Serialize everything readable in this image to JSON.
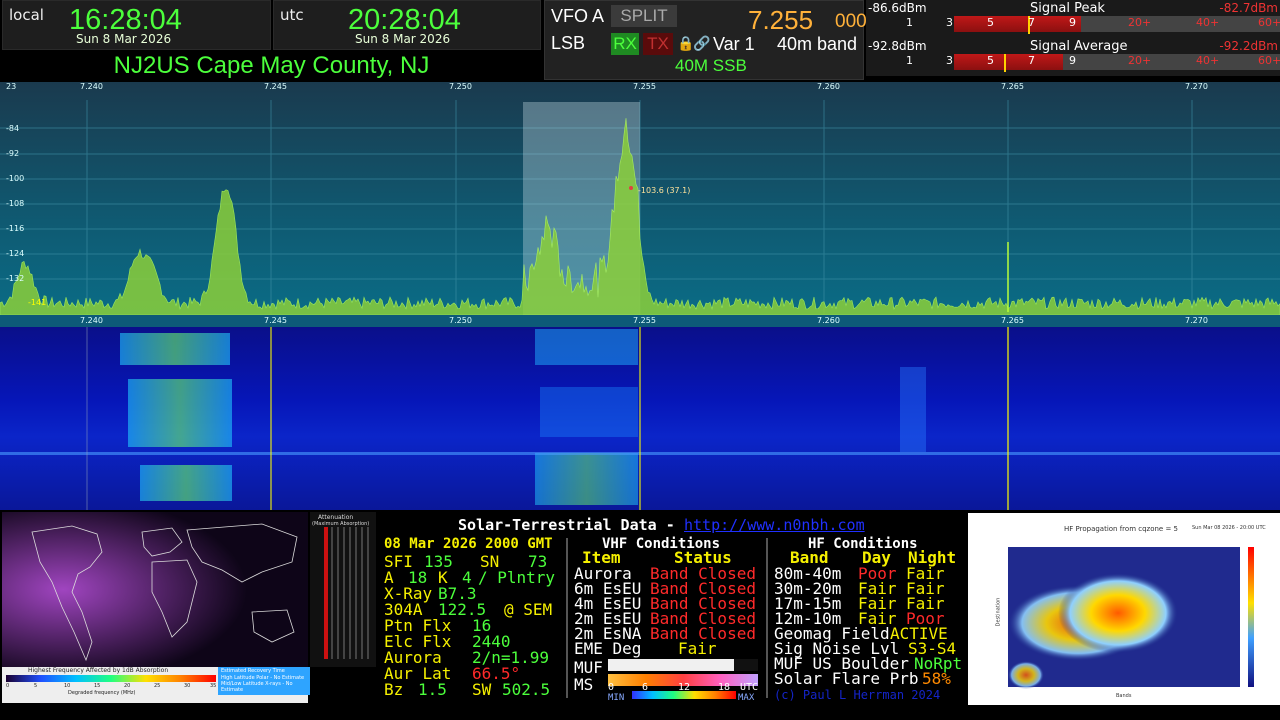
{
  "clock_local": {
    "label": "local",
    "time": "16:28:04",
    "date": "Sun 8 Mar 2026"
  },
  "clock_utc": {
    "label": "utc",
    "time": "20:28:04",
    "date": "Sun 8 Mar 2026"
  },
  "station": "NJ2US Cape May County, NJ",
  "vfo": {
    "name": "VFO A",
    "split": "SPLIT",
    "freq_main": "7.255",
    "freq_sub": "000",
    "mode": "LSB",
    "rx": "RX",
    "tx": "TX",
    "lock_icon": "🔒",
    "link_icon": "🔗",
    "var": "Var 1",
    "band": "40m band",
    "bandmode": "40M SSB"
  },
  "meter_peak": {
    "left": "-86.6dBm",
    "title": "Signal Peak",
    "right": "-82.7dBm",
    "ticks": [
      "1",
      "3",
      "5",
      "7",
      "9",
      "20+",
      "40+",
      "60+"
    ],
    "level_fraction": 0.39
  },
  "meter_avg": {
    "left": "-92.8dBm",
    "title": "Signal Average",
    "right": "-92.2dBm",
    "ticks": [
      "1",
      "3",
      "5",
      "7",
      "9",
      "20+",
      "40+",
      "60+"
    ],
    "level_fraction": 0.335
  },
  "spectrum": {
    "freq_labels": [
      "7.240",
      "7.245",
      "7.250",
      "7.255",
      "7.260",
      "7.265",
      "7.270"
    ],
    "db_labels": [
      "23",
      "-84",
      "-92",
      "-100",
      "-108",
      "-116",
      "-124",
      "-132",
      "-141"
    ],
    "marker_label": "-103.6 (37.1)"
  },
  "map": {
    "legend_title": "Highest Frequency Affected by 1dB Absorption",
    "legend_ticks": [
      "0",
      "5",
      "10",
      "15",
      "20",
      "25",
      "30",
      "35"
    ],
    "legend_axis": "Degraded frequency (MHz)",
    "recovery_title": "Estimated Recovery Time",
    "recovery_l1": "High Latitude Polar - No Estimate",
    "recovery_l2": "Mid/Low Latitude X-rays - No Estimate",
    "atten_title": "Attenuation",
    "atten_sub": "(Maximum Absorption)"
  },
  "solar": {
    "title": "Solar-Terrestrial Data -",
    "url": "http://www.n0nbh.com",
    "date": "08 Mar 2026 2000 GMT",
    "sfi_label": "SFI",
    "sfi": "135",
    "sn_label": "SN",
    "sn": "73",
    "a_label": "A",
    "a": "18",
    "k_label": "K",
    "k": "4",
    "k_status": "/ Plntry",
    "xray_label": "X-Ray",
    "xray": "B7.3",
    "he_label": "304A",
    "he": "122.5",
    "he_src": "@ SEM",
    "ptn_label": "Ptn Flx",
    "ptn": "16",
    "elc_label": "Elc Flx",
    "elc": "2440",
    "aurora_label": "Aurora",
    "aurora": "2/n=1.99",
    "aurlat_label": "Aur Lat",
    "aurlat": "66.5°",
    "bz_label": "Bz",
    "bz": "1.5",
    "sw_label": "SW",
    "sw": "502.5",
    "vhf_title": "VHF Conditions",
    "vhf_item": "Item",
    "vhf_status": "Status",
    "vhf": [
      {
        "item": "Aurora",
        "status": "Band Closed"
      },
      {
        "item": "6m EsEU",
        "status": "Band Closed"
      },
      {
        "item": "4m EsEU",
        "status": "Band Closed"
      },
      {
        "item": "2m EsEU",
        "status": "Band Closed"
      },
      {
        "item": "2m EsNA",
        "status": "Band Closed"
      }
    ],
    "eme_label": "EME Deg",
    "eme": "Fair",
    "muf_label": "MUF",
    "ms_label": "MS",
    "muf_scale": [
      "0",
      "6",
      "12",
      "18"
    ],
    "min_label": "MIN",
    "utc_label": "UTC",
    "max_label": "MAX",
    "hf_title": "HF Conditions",
    "hf_band": "Band",
    "hf_day": "Day",
    "hf_night": "Night",
    "hf": [
      {
        "band": "80m-40m",
        "day": "Poor",
        "night": "Fair"
      },
      {
        "band": "30m-20m",
        "day": "Fair",
        "night": "Fair"
      },
      {
        "band": "17m-15m",
        "day": "Fair",
        "night": "Fair"
      },
      {
        "band": "12m-10m",
        "day": "Fair",
        "night": "Poor"
      }
    ],
    "geomag_label": "Geomag Field",
    "geomag": "ACTIVE",
    "signoise_label": "Sig Noise Lvl",
    "signoise": "S3-S4",
    "mufb_label": "MUF US Boulder",
    "mufb": "NoRpt",
    "flare_label": "Solar Flare Prb",
    "flare": "58%",
    "copyright": "(c) Paul L Herrman 2024"
  },
  "prop": {
    "title": "HF Propagation from cqzone = 5",
    "date": "Sun Mar 08 2026 - 20:00 UTC",
    "ylabel": "Destination",
    "xlabel": "Bands"
  },
  "colors": {
    "green": "#4cff3c",
    "orange": "#ffb13a",
    "red": "#ff2a2a",
    "yellow": "#f5f000",
    "blue": "#2030ff"
  }
}
